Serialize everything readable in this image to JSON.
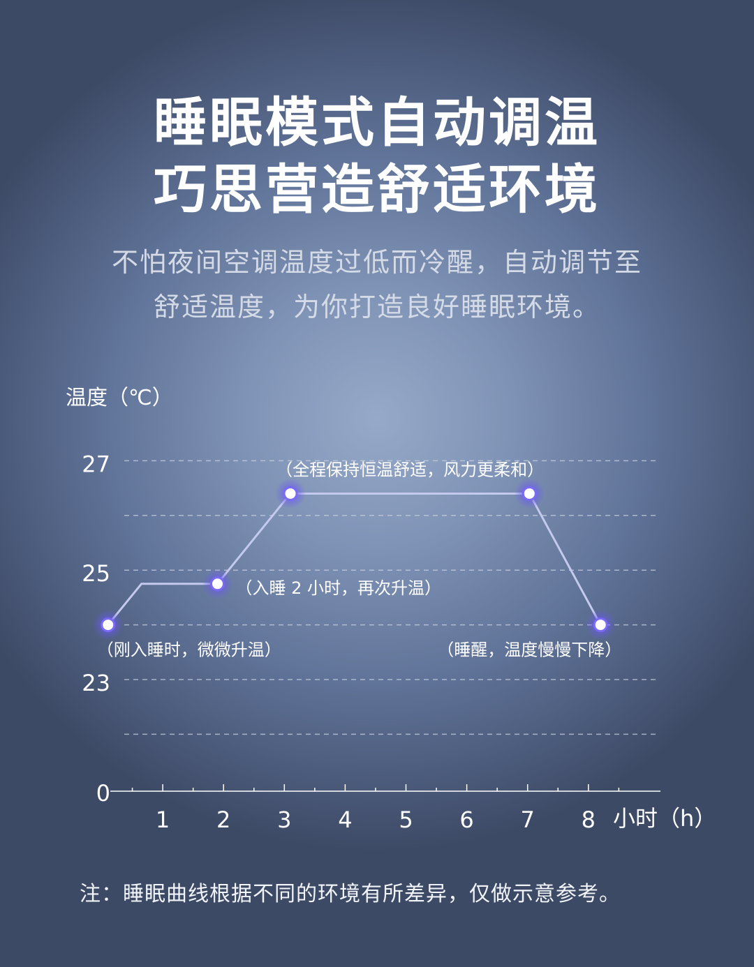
{
  "header": {
    "title_line1": "睡眠模式自动调温",
    "title_line2": "巧思营造舒适环境",
    "subtitle_line1": "不怕夜间空调温度过低而冷醒，自动调节至",
    "subtitle_line2": "舒适温度，为你打造良好睡眠环境。"
  },
  "footnote": "注：睡眠曲线根据不同的环境有所差异，仅做示意参考。",
  "chart_data": {
    "type": "line",
    "ylabel": "温度（℃）",
    "xlabel": "小时（h）",
    "x_ticks": [
      "1",
      "2",
      "3",
      "4",
      "5",
      "6",
      "7",
      "8"
    ],
    "y_ticks": [
      "0",
      "23",
      "25",
      "27"
    ],
    "series": [
      {
        "points": [
          {
            "x": 0.1,
            "y": 24.0
          },
          {
            "x": 0.65,
            "y": 24.75
          },
          {
            "x": 1.9,
            "y": 24.75
          },
          {
            "x": 3.1,
            "y": 26.4
          },
          {
            "x": 7.03,
            "y": 26.4
          },
          {
            "x": 8.2,
            "y": 24.0
          }
        ]
      }
    ],
    "markers": [
      {
        "x": 0.1,
        "y": 24.0,
        "label": "（刚入睡时，微微升温）"
      },
      {
        "x": 1.9,
        "y": 24.75,
        "label": "（入睡 2 小时，再次升温）"
      },
      {
        "x": 3.1,
        "y": 26.4,
        "label": ""
      },
      {
        "x": 7.03,
        "y": 26.4,
        "label": ""
      },
      {
        "x": 8.2,
        "y": 24.0,
        "label": "（睡醒，温度慢慢下降）"
      }
    ],
    "plateau_label": "（全程保持恒温舒适，风力更柔和）",
    "grid": "dashed",
    "colors": {
      "line": "#c4c9ee",
      "marker_glow": "#6f5cf2",
      "marker_fill": "#ffffff",
      "grid": "#c8d0e0"
    }
  }
}
